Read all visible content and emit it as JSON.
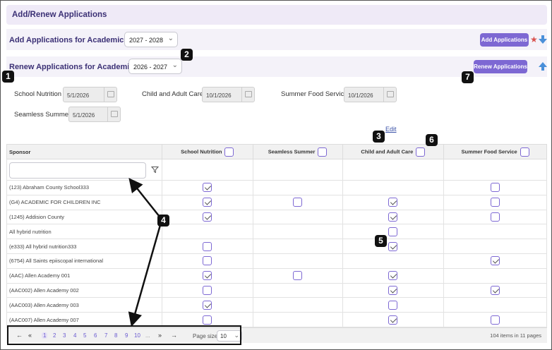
{
  "header": {
    "title": "Add/Renew Applications"
  },
  "add_row": {
    "label": "Add Applications for Academic Year",
    "year": "2027 - 2028",
    "button": "Add Applications"
  },
  "renew_row": {
    "label": "Renew Applications for Academic Year",
    "year": "2026 - 2027",
    "button": "Renew Applications"
  },
  "dates": {
    "school_nutrition": {
      "label": "School Nutrition",
      "value": "5/1/2026"
    },
    "child_adult_care": {
      "label": "Child and Adult Care",
      "value": "10/1/2026"
    },
    "summer_food": {
      "label": "Summer Food Service",
      "value": "10/1/2026"
    },
    "seamless_summer": {
      "label": "Seamless Summer",
      "value": "5/1/2026"
    }
  },
  "edit_link": "Edit",
  "table": {
    "columns": [
      "Sponsor",
      "School Nutrition",
      "Seamless Summer",
      "Child and Adult Care",
      "Summer Food Service"
    ],
    "rows": [
      {
        "name": "(123) Abraham County School333",
        "cells": [
          1,
          -1,
          -1,
          0
        ]
      },
      {
        "name": "(G4) ACADEMIC FOR CHILDREN INC",
        "cells": [
          1,
          0,
          1,
          0
        ]
      },
      {
        "name": "(1245) Addision County",
        "cells": [
          1,
          -1,
          1,
          0
        ]
      },
      {
        "name": "All hybrid nutrition",
        "cells": [
          -1,
          -1,
          0,
          -1
        ]
      },
      {
        "name": "(e333) All hybrid nutrition333",
        "cells": [
          0,
          -1,
          1,
          -1
        ]
      },
      {
        "name": "(6754) All Saints epiiscopal international",
        "cells": [
          0,
          -1,
          -1,
          1
        ]
      },
      {
        "name": "(AAC) Allen Academy 001",
        "cells": [
          1,
          0,
          1,
          -1
        ]
      },
      {
        "name": "(AAC002) Allen Academy 002",
        "cells": [
          0,
          -1,
          1,
          1
        ]
      },
      {
        "name": "(AAC003) Allen Academy 003",
        "cells": [
          1,
          -1,
          0,
          -1
        ]
      },
      {
        "name": "(AAC007) Allen Academy 007",
        "cells": [
          0,
          -1,
          1,
          0
        ]
      }
    ]
  },
  "pager": {
    "first": "←",
    "prev": "«",
    "pages": [
      "1",
      "2",
      "3",
      "4",
      "5",
      "6",
      "7",
      "8",
      "9",
      "10"
    ],
    "ellipsis": "...",
    "next": "»",
    "last": "→",
    "size_label": "Page size:",
    "size_value": "10",
    "items_info": "104 items in 11 pages"
  },
  "callouts": [
    "1",
    "2",
    "3",
    "4",
    "5",
    "6",
    "7"
  ],
  "colors": {
    "accent": "#7d68d3",
    "header_text": "#3b3075",
    "band": "#f4f2f9"
  },
  "icons": [
    "chevron-down-icon",
    "calendar-icon",
    "filter-icon",
    "star-icon",
    "download-arrow-icon",
    "upload-arrow-icon"
  ]
}
